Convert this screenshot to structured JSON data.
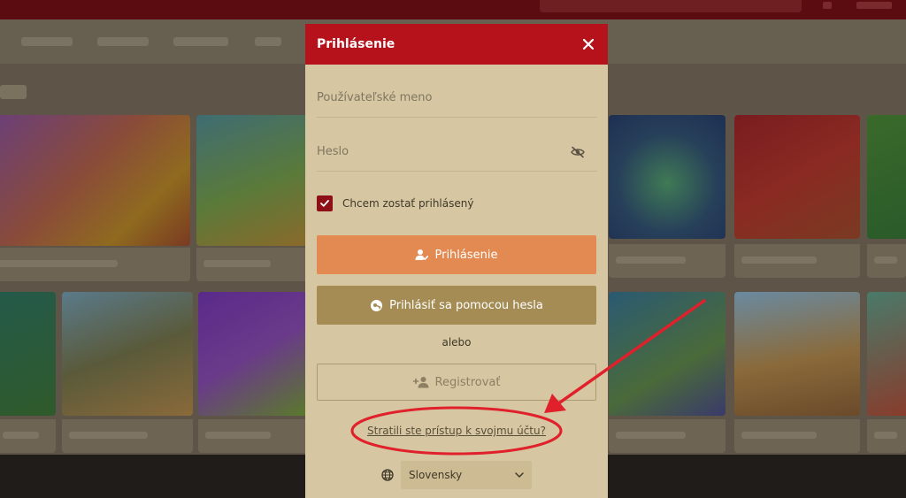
{
  "modal": {
    "title": "Prihlásenie",
    "username_placeholder": "Používateľské meno",
    "password_placeholder": "Heslo",
    "remember_label": "Chcem zostať prihlásený",
    "remember_checked": true,
    "login_button": "Prihlásenie",
    "password_login_button": "Prihlásiť sa pomocou hesla",
    "or_text": "alebo",
    "register_button": "Registrovať",
    "lost_access_link": "Stratili ste prístup k svojmu účtu?",
    "language": "Slovensky"
  },
  "icons": {
    "close": "close-icon",
    "password_visibility": "eye-off-icon",
    "remember_check": "check-icon",
    "login": "user-check-icon",
    "password_login": "key-icon",
    "register": "user-plus-icon",
    "language": "globe-icon",
    "language_dropdown": "chevron-down-icon"
  },
  "colors": {
    "header": "#b5121b",
    "modal_bg": "#d6c7a2",
    "login_button": "#e28a52",
    "password_button": "#a48c54",
    "checkbox": "#8e1017",
    "annotation": "#e0202a"
  }
}
